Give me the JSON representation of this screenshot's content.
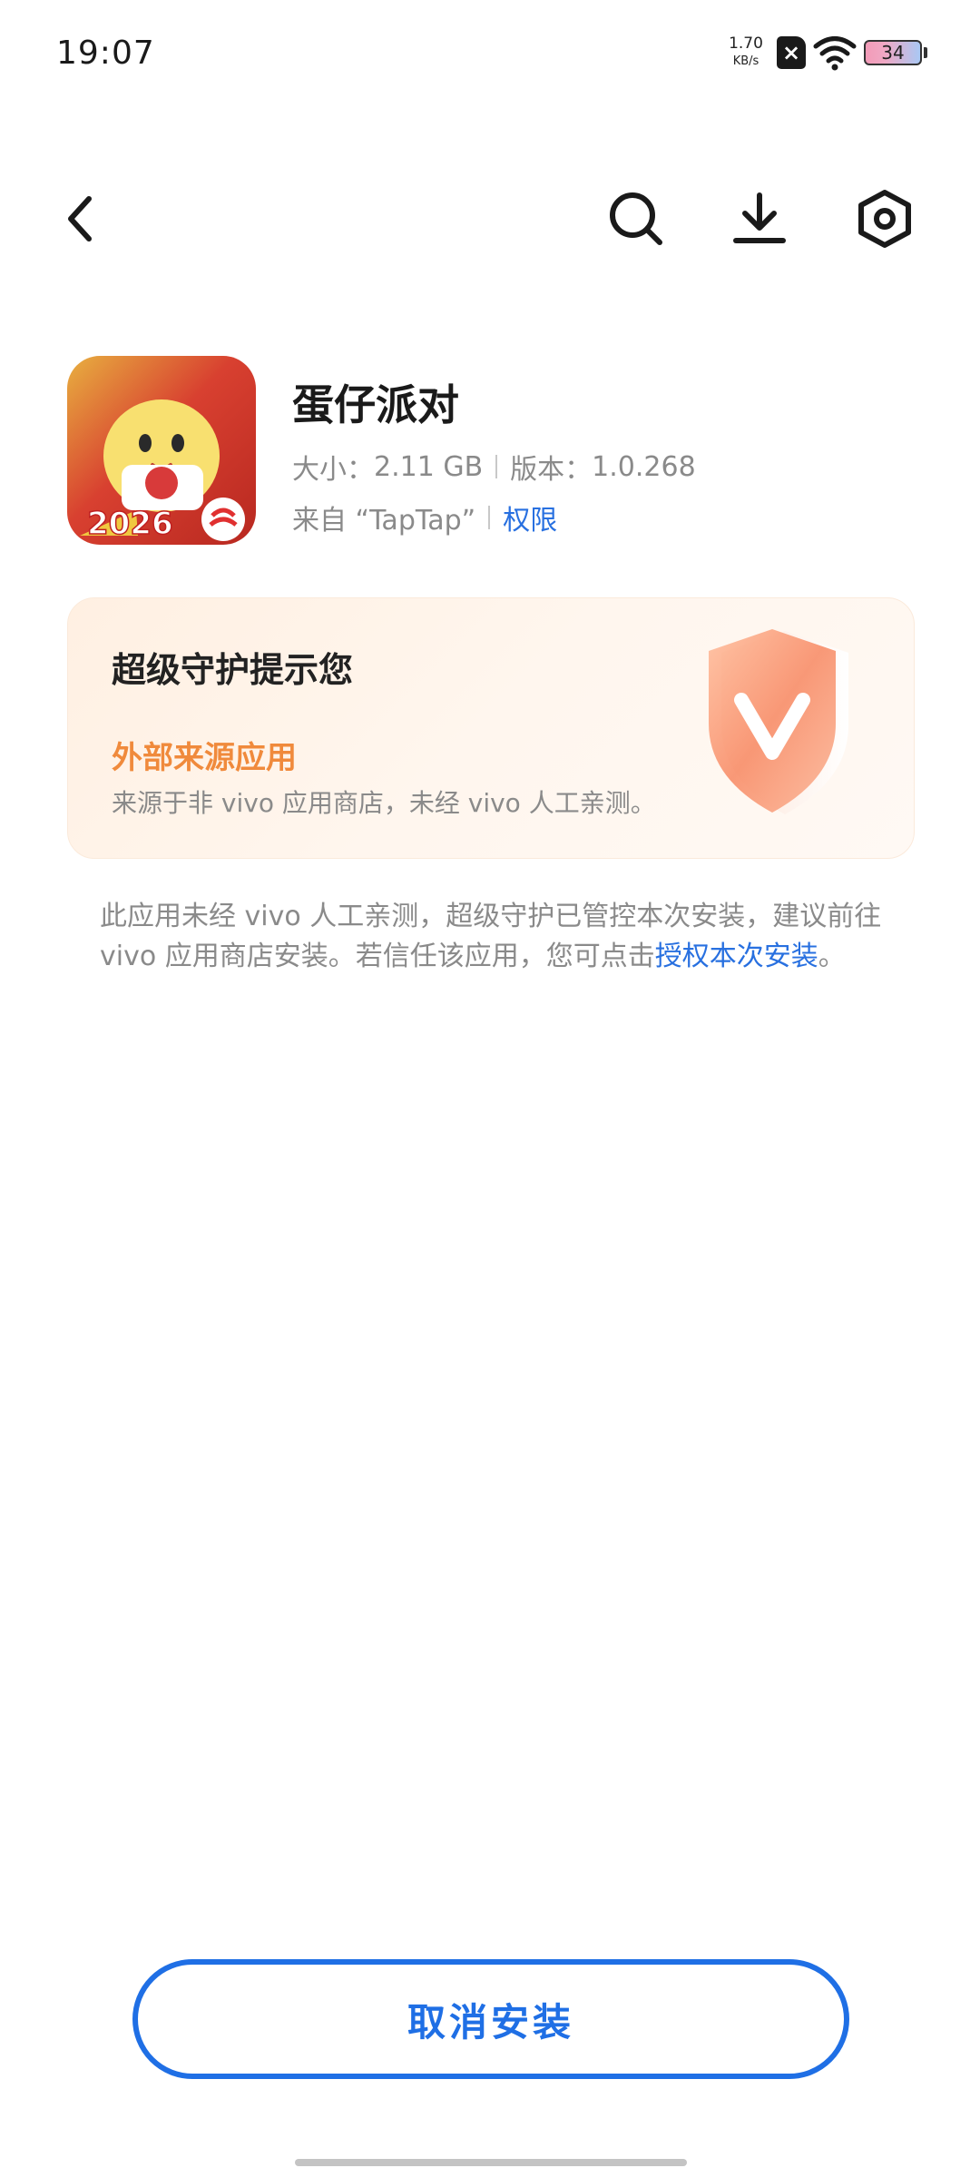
{
  "status_bar": {
    "time": "19:07",
    "net_speed_value": "1.70",
    "net_speed_unit": "KB/s",
    "battery_level": "34"
  },
  "toolbar": {
    "icons": [
      "back-arrow-icon",
      "search-icon",
      "download-icon",
      "settings-hexagon-icon"
    ]
  },
  "app": {
    "name": "蛋仔派对",
    "size_label": "大小：",
    "size_value": "2.11 GB",
    "version_label": "版本：",
    "version_value": "1.0.268",
    "source": "来自 “TapTap”",
    "permissions_link": "权限",
    "icon_text": "2026"
  },
  "warning_card": {
    "title": "超级守护提示您",
    "subtitle": "外部来源应用",
    "description": "来源于非 vivo 应用商店，未经 vivo 人工亲测。"
  },
  "notice": {
    "text": "此应用未经 vivo 人工亲测，超级守护已管控本次安装，建议前往 vivo 应用商店安装。若信任该应用，您可点击",
    "link": "授权本次安装",
    "end": "。"
  },
  "bottom": {
    "cancel_label": "取消安装"
  },
  "colors": {
    "accent_blue": "#1f6fe5",
    "warning_orange": "#f08a3c",
    "card_bg": "#fff3e8"
  }
}
